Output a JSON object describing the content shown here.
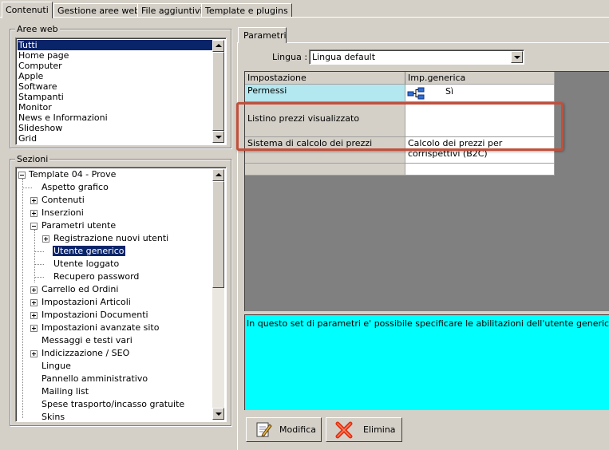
{
  "top_tabs": [
    "Contenuti",
    "Gestione aree web",
    "File aggiuntivi",
    "Template e plugins"
  ],
  "aree_web": {
    "title": "Aree web",
    "items": [
      "Tutti",
      "Home page",
      "Computer",
      "Apple",
      "Software",
      "Stampanti",
      "Monitor",
      "News e Informazioni",
      "Slideshow",
      "Grid"
    ],
    "selected": "Tutti"
  },
  "sezioni": {
    "title": "Sezioni",
    "nodes": [
      {
        "label": "Template 04 - Prove"
      },
      {
        "label": "Aspetto grafico"
      },
      {
        "label": "Contenuti"
      },
      {
        "label": "Inserzioni"
      },
      {
        "label": "Parametri utente"
      },
      {
        "label": "Registrazione nuovi utenti"
      },
      {
        "label": "Utente generico"
      },
      {
        "label": "Utente loggato"
      },
      {
        "label": "Recupero password"
      },
      {
        "label": "Carrello ed Ordini"
      },
      {
        "label": "Impostazioni Articoli"
      },
      {
        "label": "Impostazioni Documenti"
      },
      {
        "label": "Impostazioni avanzate sito"
      },
      {
        "label": "Messaggi e testi vari"
      },
      {
        "label": "Indicizzazione / SEO"
      },
      {
        "label": "Lingue"
      },
      {
        "label": "Pannello amministrativo"
      },
      {
        "label": "Mailing list"
      },
      {
        "label": "Spese trasporto/incasso gratuite"
      },
      {
        "label": "Skins"
      }
    ],
    "selected": "Utente generico"
  },
  "parametri": {
    "tab": "Parametri",
    "lingua_label": "Lingua :",
    "lingua_value": "Lingua default",
    "headers": [
      "Impostazione",
      "Imp.generica"
    ],
    "rows": [
      {
        "setting": "Permessi",
        "value": "Sì"
      },
      {
        "setting": "Listino prezzi visualizzato",
        "value": ""
      },
      {
        "setting": "Sistema di calcolo dei prezzi",
        "value": "Calcolo dei prezzi per corrispettivi (B2C)"
      },
      {
        "setting": "",
        "value": ""
      }
    ],
    "description": "In questo set di parametri e' possibile specificare le abilitazioni dell'utente generico per la navigazione",
    "buttons": {
      "modifica": "Modifica",
      "elimina": "Elimina"
    },
    "colors": {
      "highlight_cell": "#b4e8f0",
      "description_bg": "#00ffff",
      "annotation_box": "#c0503c",
      "grid_empty_bg": "#808080"
    }
  }
}
